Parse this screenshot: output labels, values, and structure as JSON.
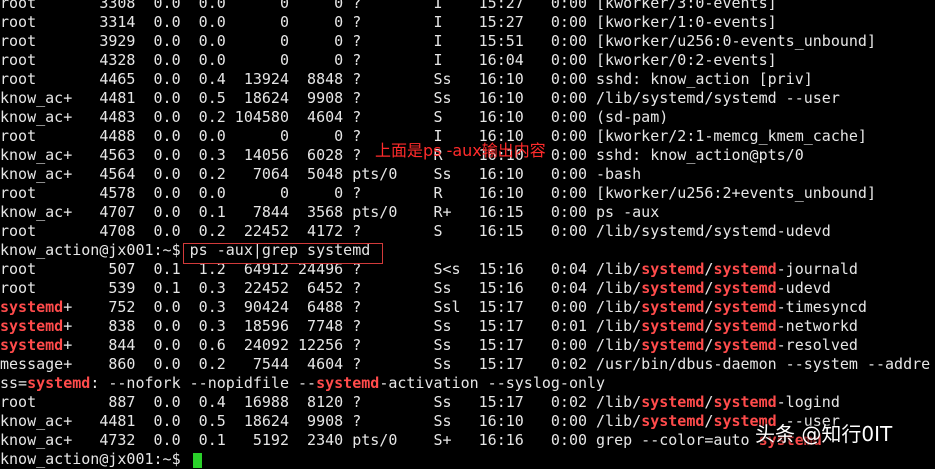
{
  "terminal": {
    "lines": [
      {
        "segments": [
          {
            "t": "root       3308  0.0  0.0      0     0 ?        I    15:27   0:00 [kworker/3:0-events]"
          }
        ]
      },
      {
        "segments": [
          {
            "t": "root       3314  0.0  0.0      0     0 ?        I    15:27   0:00 [kworker/1:0-events]"
          }
        ]
      },
      {
        "segments": [
          {
            "t": "root       3929  0.0  0.0      0     0 ?        I    15:51   0:00 [kworker/u256:0-events_unbound]"
          }
        ]
      },
      {
        "segments": [
          {
            "t": "root       4328  0.0  0.0      0     0 ?        I    16:04   0:00 [kworker/0:2-events]"
          }
        ]
      },
      {
        "segments": [
          {
            "t": "root       4465  0.0  0.4  13924  8848 ?        Ss   16:10   0:00 sshd: know_action [priv]"
          }
        ]
      },
      {
        "segments": [
          {
            "t": "know_ac+   4481  0.0  0.5  18624  9908 ?        Ss   16:10   0:00 /lib/systemd/systemd --user"
          }
        ]
      },
      {
        "segments": [
          {
            "t": "know_ac+   4483  0.0  0.2 104580  4604 ?        S    16:10   0:00 (sd-pam)"
          }
        ]
      },
      {
        "segments": [
          {
            "t": "root       4488  0.0  0.0      0     0 ?        I    16:10   0:00 [kworker/2:1-memcg_kmem_cache]"
          }
        ]
      },
      {
        "segments": [
          {
            "t": "know_ac+   4563  0.0  0.3  14056  6028 ?        R    16:10   0:00 sshd: know_action@pts/0"
          }
        ]
      },
      {
        "segments": [
          {
            "t": "know_ac+   4564  0.0  0.2   7064  5048 pts/0    Ss   16:10   0:00 -bash"
          }
        ]
      },
      {
        "segments": [
          {
            "t": "root       4578  0.0  0.0      0     0 ?        R    16:10   0:00 [kworker/u256:2+events_unbound]"
          }
        ]
      },
      {
        "segments": [
          {
            "t": "know_ac+   4707  0.0  0.1   7844  3568 pts/0    R+   16:15   0:00 ps -aux"
          }
        ]
      },
      {
        "segments": [
          {
            "t": "root       4708  0.0  0.2  22452  4172 ?        S    16:15   0:00 /lib/systemd/systemd-udevd"
          }
        ]
      },
      {
        "segments": [
          {
            "t": "know_action@jx001:~$ ps -aux|grep systemd"
          }
        ]
      },
      {
        "segments": [
          {
            "t": "root        507  0.1  1.2  64912 24496 ?        S<s  15:16   0:04 /lib/"
          },
          {
            "t": "systemd",
            "hl": true
          },
          {
            "t": "/"
          },
          {
            "t": "systemd",
            "hl": true
          },
          {
            "t": "-journald"
          }
        ]
      },
      {
        "segments": [
          {
            "t": "root        539  0.1  0.3  22452  6452 ?        Ss   15:16   0:04 /lib/"
          },
          {
            "t": "systemd",
            "hl": true
          },
          {
            "t": "/"
          },
          {
            "t": "systemd",
            "hl": true
          },
          {
            "t": "-udevd"
          }
        ]
      },
      {
        "segments": [
          {
            "t": "systemd",
            "hl": true
          },
          {
            "t": "+    752  0.0  0.3  90424  6488 ?        Ssl  15:17   0:00 /lib/"
          },
          {
            "t": "systemd",
            "hl": true
          },
          {
            "t": "/"
          },
          {
            "t": "systemd",
            "hl": true
          },
          {
            "t": "-timesyncd"
          }
        ]
      },
      {
        "segments": [
          {
            "t": "systemd",
            "hl": true
          },
          {
            "t": "+    838  0.0  0.3  18596  7748 ?        Ss   15:17   0:01 /lib/"
          },
          {
            "t": "systemd",
            "hl": true
          },
          {
            "t": "/"
          },
          {
            "t": "systemd",
            "hl": true
          },
          {
            "t": "-networkd"
          }
        ]
      },
      {
        "segments": [
          {
            "t": "systemd",
            "hl": true
          },
          {
            "t": "+    844  0.0  0.6  24092 12256 ?        Ss   15:17   0:00 /lib/"
          },
          {
            "t": "systemd",
            "hl": true
          },
          {
            "t": "/"
          },
          {
            "t": "systemd",
            "hl": true
          },
          {
            "t": "-resolved"
          }
        ]
      },
      {
        "segments": [
          {
            "t": "message+    860  0.0  0.2   7544  4604 ?        Ss   15:17   0:02 /usr/bin/dbus-daemon --system --addre"
          }
        ]
      },
      {
        "segments": [
          {
            "t": "ss="
          },
          {
            "t": "systemd",
            "hl": true
          },
          {
            "t": ": --nofork --nopidfile --"
          },
          {
            "t": "systemd",
            "hl": true
          },
          {
            "t": "-activation --syslog-only"
          }
        ]
      },
      {
        "segments": [
          {
            "t": "root        887  0.0  0.4  16988  8120 ?        Ss   15:17   0:02 /lib/"
          },
          {
            "t": "systemd",
            "hl": true
          },
          {
            "t": "/"
          },
          {
            "t": "systemd",
            "hl": true
          },
          {
            "t": "-logind"
          }
        ]
      },
      {
        "segments": [
          {
            "t": "know_ac+   4481  0.0  0.5  18624  9908 ?        Ss   16:10   0:00 /lib/"
          },
          {
            "t": "systemd",
            "hl": true
          },
          {
            "t": "/"
          },
          {
            "t": "systemd",
            "hl": true
          },
          {
            "t": " --user"
          }
        ]
      },
      {
        "segments": [
          {
            "t": "know_ac+   4732  0.0  0.1   5192  2340 pts/0    S+   16:16   0:00 grep --color=auto "
          },
          {
            "t": "systemd",
            "hl": true
          }
        ]
      },
      {
        "segments": [
          {
            "t": "know_action@jx001:~$ "
          }
        ]
      }
    ],
    "highlight_color": "#ff4b4b",
    "cursor_color": "#2ad02a"
  },
  "annotation": {
    "text": "上面是ps -aux输出内容",
    "color": "#ff2b2b"
  },
  "watermark": {
    "text": "头条 @知行0IT"
  }
}
